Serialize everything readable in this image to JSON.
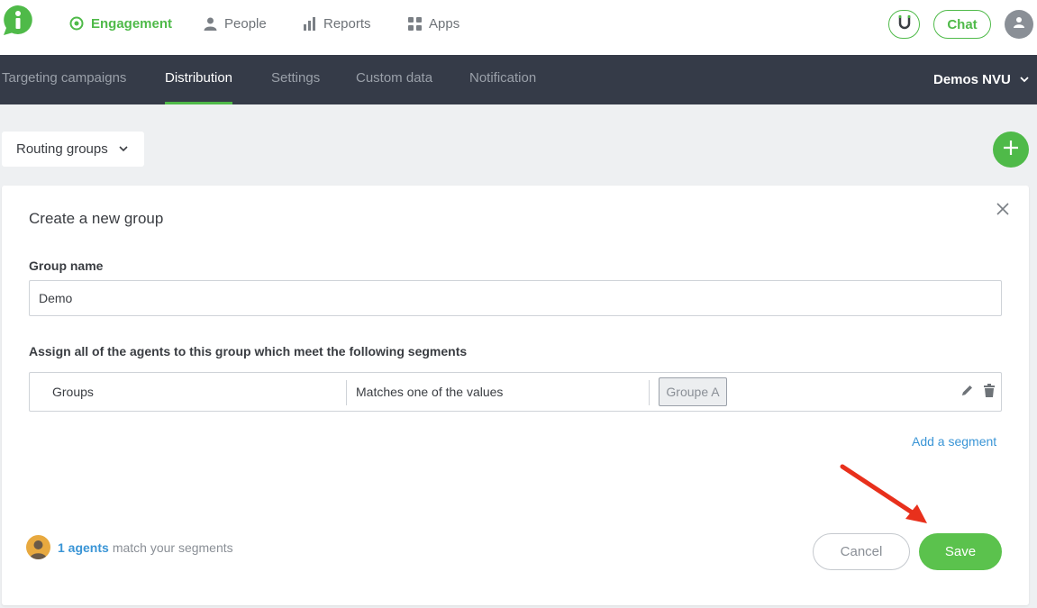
{
  "topnav": {
    "items": [
      {
        "label": "Engagement",
        "icon": "target-icon",
        "active": true
      },
      {
        "label": "People",
        "icon": "person-icon"
      },
      {
        "label": "Reports",
        "icon": "bar-chart-icon"
      },
      {
        "label": "Apps",
        "icon": "grid-icon"
      }
    ],
    "chat_label": "Chat",
    "brand_color": "#4fba49"
  },
  "subnav": {
    "tabs": [
      {
        "label": "Targeting campaigns"
      },
      {
        "label": "Distribution",
        "active": true
      },
      {
        "label": "Settings"
      },
      {
        "label": "Custom data"
      },
      {
        "label": "Notification"
      }
    ],
    "account": "Demos NVU"
  },
  "routing": {
    "selected": "Routing groups"
  },
  "form": {
    "title": "Create a new group",
    "group_name_label": "Group name",
    "group_name_value": "Demo",
    "assign_label": "Assign all of the agents to this group which meet the following segments",
    "segment": {
      "field": "Groups",
      "operator": "Matches one of the values",
      "value": "Groupe A"
    },
    "add_segment": "Add a segment",
    "agents_count": "1 agents",
    "agents_text": "match your segments",
    "cancel": "Cancel",
    "save": "Save"
  }
}
